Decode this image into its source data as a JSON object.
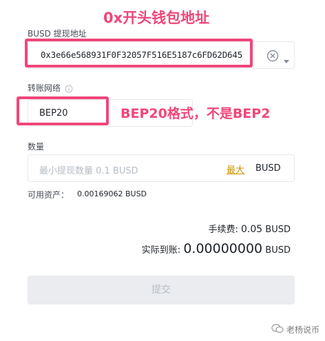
{
  "address": {
    "label": "BUSD 提现地址",
    "value": "0x3e66e568931F0F32057F516E5187c6FD62D645",
    "clear_icon": "clear-circle-icon",
    "dropdown_icon": "chevron-down-icon"
  },
  "network": {
    "label": "转账网络",
    "info_icon": "info-circle-icon",
    "value": "BEP20"
  },
  "amount": {
    "label": "数量",
    "placeholder": "最小提现数量 0.1 BUSD",
    "max_label": "最大",
    "unit": "BUSD",
    "available_label": "可用资产：",
    "available_value": "0.00169062 BUSD"
  },
  "summary": {
    "fee_label": "手续费:",
    "fee_value": "0.05",
    "fee_unit": "BUSD",
    "received_label": "实际到账:",
    "received_value": "0.00000000",
    "received_unit": "BUSD"
  },
  "submit": {
    "label": "提交"
  },
  "annotations": {
    "address_note": "0x开头钱包地址",
    "network_note": "BEP20格式，不是BEP2",
    "color": "#f0467a"
  },
  "watermark": {
    "text": "老杨说币",
    "icon": "wechat-icon"
  }
}
